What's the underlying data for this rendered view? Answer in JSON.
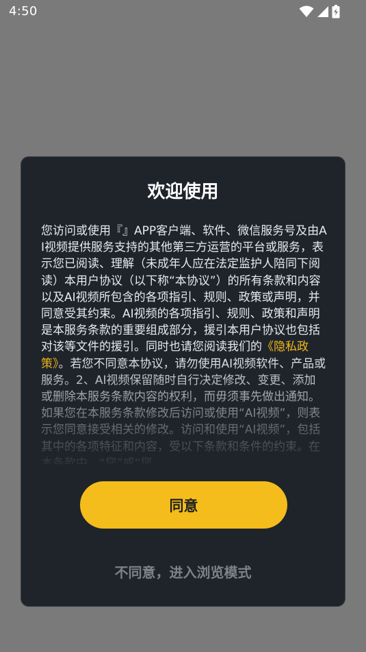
{
  "status_bar": {
    "time": "4:50",
    "icons": [
      "wifi-icon",
      "cellular-signal-icon",
      "battery-charging-icon"
    ]
  },
  "dialog": {
    "title": "欢迎使用",
    "body_before_link": "您访问或使用『』APP客户端、软件、微信服务号及由AI视频提供服务支持的其他第三方运营的平台或服务，表示您已阅读、理解（未成年人应在法定监护人陪同下阅读）本用户协议（以下称“本协议”）的所有条款和内容以及AI视频所包含的各项指引、规则、政策或声明，并同意受其约束。AI视频的各项指引、规则、政策和声明是本服务条款的重要组成部分，援引本用户协议也包括对该等文件的援引。同时也请您阅读我们的",
    "privacy_link": "《隐私政策》",
    "body_after_link": "。若您不同意本协议，请勿使用AI视频软件、产品或服务。2、AI视频保留随时自行决定修改、变更、添加或删除本服务条款内容的权利，而毋须事先做出通知。如果您在本服务条款修改后访问或使用“AI视频”，则表示您同意接受相关的修改。访问和使用“AI视频”，包括其中的各项特征和内容，受以下条款和条件的约束。在本条款中，“您”或“您",
    "agree_label": "同意",
    "disagree_label": "不同意，进入浏览模式"
  },
  "colors": {
    "backdrop": "#7a7a7a",
    "dialog_bg": "#1f242b",
    "accent": "#f4bd1b",
    "link": "#f3b91a",
    "muted_text": "#7d8288"
  }
}
